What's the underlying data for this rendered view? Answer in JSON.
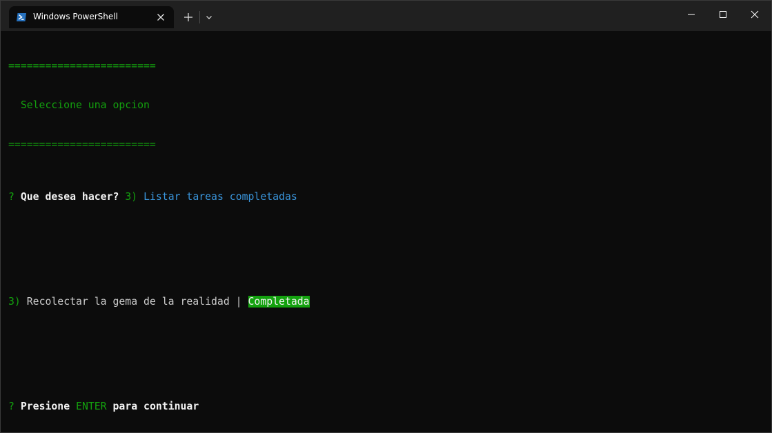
{
  "window": {
    "tab_title": "Windows PowerShell",
    "tab_icon": "powershell-icon",
    "buttons": [
      "new-tab-icon",
      "chevron-down-icon",
      "minimize-icon",
      "maximize-icon",
      "close-icon"
    ],
    "accent": "#012456"
  },
  "terminal": {
    "separator_top": "========================",
    "menu_title": "  Seleccione una opcion",
    "separator_bottom": "========================",
    "prompt1": {
      "mark": "?",
      "question": "Que desea hacer?",
      "answer_number": "3)",
      "answer_text": "Listar tareas completadas"
    },
    "task": {
      "number": "3)",
      "description": "Recolectar la gema de la realidad",
      "separator": "|",
      "status": "Completada"
    },
    "prompt2": {
      "mark": "?",
      "text_before": "Presione",
      "key": "ENTER",
      "text_after": "para continuar"
    },
    "colors": {
      "background": "#0c0c0c",
      "green": "#13a10e",
      "blue": "#3a96dd",
      "text": "#cccccc"
    }
  }
}
